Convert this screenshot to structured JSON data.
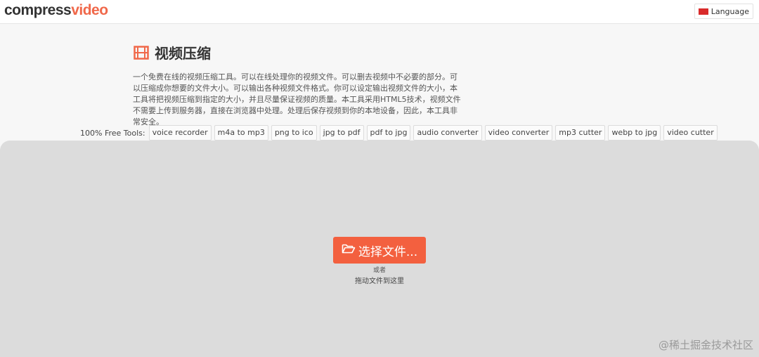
{
  "header": {
    "logo_part1": "compress",
    "logo_part2": "video",
    "language_label": "Language"
  },
  "intro": {
    "title": "视频压缩",
    "description": "一个免费在线的视频压缩工具。可以在线处理你的视频文件。可以删去视频中不必要的部分。可以压缩成你想要的文件大小。可以输出各种视频文件格式。你可以设定输出视频文件的大小，本工具将把视频压缩到指定的大小，并且尽量保证视频的质量。本工具采用HTML5技术，视频文件不需要上传到服务器，直接在浏览器中处理。处理后保存视频到你的本地设备，因此，本工具非常安全。"
  },
  "tools": {
    "label": "100% Free Tools:",
    "items": [
      "voice recorder",
      "m4a to mp3",
      "png to ico",
      "jpg to pdf",
      "pdf to jpg",
      "audio converter",
      "video converter",
      "mp3 cutter",
      "webp to jpg",
      "video cutter"
    ]
  },
  "dropzone": {
    "choose_button": "选择文件...",
    "or_text": "或者",
    "drag_text": "拖动文件到这里"
  },
  "watermark": "@稀土掘金技术社区",
  "colors": {
    "accent": "#f3603f",
    "logo_accent": "#f0684a",
    "dropzone_bg": "#dcdcdc"
  },
  "icons": {
    "title_icon": "film-icon",
    "button_icon": "folder-open-icon",
    "language_icon": "flag-icon"
  }
}
